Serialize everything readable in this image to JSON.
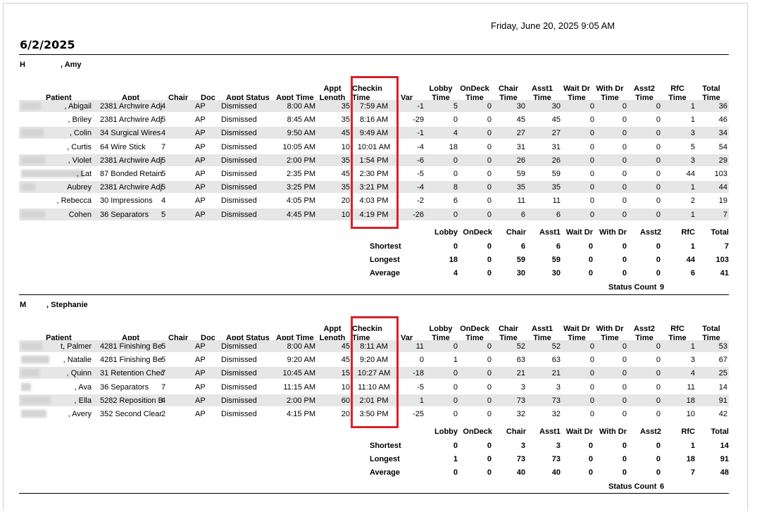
{
  "printed": "Friday, June 20, 2025 9:05 AM",
  "report_date": "6/2/2025",
  "headers": {
    "patient": "Patient",
    "appt": "Appt",
    "chair": "Chair",
    "doc": "Doc",
    "appt_status": "Appt Status",
    "appt_time": "Appt Time",
    "appt_length": [
      "Appt",
      "Length"
    ],
    "checkin": [
      "Checkin",
      "Time"
    ],
    "var": "Var",
    "lobby": [
      "Lobby",
      "Time"
    ],
    "ondeck": [
      "OnDeck",
      "Time"
    ],
    "chair_time": [
      "Chair",
      "Time"
    ],
    "asst1": [
      "Asst1",
      "Time"
    ],
    "wait_dr": [
      "Wait Dr",
      "Time"
    ],
    "with_dr": [
      "With Dr",
      "Time"
    ],
    "asst2": [
      "Asst2",
      "Time"
    ],
    "rfc": [
      "RfC",
      "Time"
    ],
    "total": [
      "Total",
      "Time"
    ]
  },
  "summary_headers": [
    "Lobby",
    "OnDeck",
    "Chair",
    "Asst1",
    "Wait Dr",
    "With Dr",
    "Asst2",
    "RfC",
    "Total"
  ],
  "status_count_label": "Status Count",
  "groups": [
    {
      "doctor": [
        "H",
        ", Amy"
      ],
      "rows": [
        {
          "patient": ", Abigail",
          "appt": "2381 Archwire Adj",
          "chair": "4",
          "doc": "AP",
          "status": "Dismissed",
          "time": "8:00 AM",
          "len": "35",
          "checkin": "7:59 AM",
          "var": "-1",
          "lobby": "5",
          "ondeck": "0",
          "chairt": "30",
          "asst1": "30",
          "waitdr": "0",
          "withdr": "0",
          "asst2": "0",
          "rfc": "1",
          "total": "36"
        },
        {
          "patient": ", Briley",
          "appt": "2381 Archwire Adj",
          "chair": "5",
          "doc": "AP",
          "status": "Dismissed",
          "time": "8:45 AM",
          "len": "35",
          "checkin": "8:16 AM",
          "var": "-29",
          "lobby": "0",
          "ondeck": "0",
          "chairt": "45",
          "asst1": "45",
          "waitdr": "0",
          "withdr": "0",
          "asst2": "0",
          "rfc": "1",
          "total": "46"
        },
        {
          "patient": ", Colin",
          "appt": "34 Surgical Wires",
          "chair": "4",
          "doc": "AP",
          "status": "Dismissed",
          "time": "9:50 AM",
          "len": "45",
          "checkin": "9:49 AM",
          "var": "-1",
          "lobby": "4",
          "ondeck": "0",
          "chairt": "27",
          "asst1": "27",
          "waitdr": "0",
          "withdr": "0",
          "asst2": "0",
          "rfc": "3",
          "total": "34"
        },
        {
          "patient": ", Curtis",
          "appt": "64 Wire Stick",
          "chair": "7",
          "doc": "AP",
          "status": "Dismissed",
          "time": "10:05 AM",
          "len": "10",
          "checkin": "10:01 AM",
          "var": "-4",
          "lobby": "18",
          "ondeck": "0",
          "chairt": "31",
          "asst1": "31",
          "waitdr": "0",
          "withdr": "0",
          "asst2": "0",
          "rfc": "5",
          "total": "54"
        },
        {
          "patient": ", Violet",
          "appt": "2381 Archwire Adj",
          "chair": "5",
          "doc": "AP",
          "status": "Dismissed",
          "time": "2:00 PM",
          "len": "35",
          "checkin": "1:54 PM",
          "var": "-6",
          "lobby": "0",
          "ondeck": "0",
          "chairt": "26",
          "asst1": "26",
          "waitdr": "0",
          "withdr": "0",
          "asst2": "0",
          "rfc": "3",
          "total": "29"
        },
        {
          "patient": ", Lat",
          "appt": "87 Bonded Retain",
          "chair": "5",
          "doc": "AP",
          "status": "Dismissed",
          "time": "2:35 PM",
          "len": "45",
          "checkin": "2:30 PM",
          "var": "-5",
          "lobby": "0",
          "ondeck": "0",
          "chairt": "59",
          "asst1": "59",
          "waitdr": "0",
          "withdr": "0",
          "asst2": "0",
          "rfc": "44",
          "total": "103"
        },
        {
          "patient": "Aubrey",
          "appt": "2381 Archwire Adj",
          "chair": "5",
          "doc": "AP",
          "status": "Dismissed",
          "time": "3:25 PM",
          "len": "35",
          "checkin": "3:21 PM",
          "var": "-4",
          "lobby": "8",
          "ondeck": "0",
          "chairt": "35",
          "asst1": "35",
          "waitdr": "0",
          "withdr": "0",
          "asst2": "0",
          "rfc": "1",
          "total": "44"
        },
        {
          "patient": ", Rebecca",
          "appt": "30 Impressions",
          "chair": "4",
          "doc": "AP",
          "status": "Dismissed",
          "time": "4:05 PM",
          "len": "20",
          "checkin": "4:03 PM",
          "var": "-2",
          "lobby": "6",
          "ondeck": "0",
          "chairt": "11",
          "asst1": "11",
          "waitdr": "0",
          "withdr": "0",
          "asst2": "0",
          "rfc": "2",
          "total": "19"
        },
        {
          "patient": "Cohen",
          "appt": "36 Separators",
          "chair": "5",
          "doc": "AP",
          "status": "Dismissed",
          "time": "4:45 PM",
          "len": "10",
          "checkin": "4:19 PM",
          "var": "-26",
          "lobby": "0",
          "ondeck": "0",
          "chairt": "6",
          "asst1": "6",
          "waitdr": "0",
          "withdr": "0",
          "asst2": "0",
          "rfc": "1",
          "total": "7"
        }
      ],
      "summary": [
        {
          "label": "Shortest",
          "values": [
            "0",
            "0",
            "6",
            "6",
            "0",
            "0",
            "0",
            "1",
            "7"
          ]
        },
        {
          "label": "Longest",
          "values": [
            "18",
            "0",
            "59",
            "59",
            "0",
            "0",
            "0",
            "44",
            "103"
          ]
        },
        {
          "label": "Average",
          "values": [
            "4",
            "0",
            "30",
            "30",
            "0",
            "0",
            "0",
            "6",
            "41"
          ]
        }
      ],
      "status_count": "9"
    },
    {
      "doctor": [
        "M",
        ", Stephanie"
      ],
      "rows": [
        {
          "patient": "t, Palmer",
          "appt": "4281 Finishing Be",
          "chair": "5",
          "doc": "AP",
          "status": "Dismissed",
          "time": "8:00 AM",
          "len": "45",
          "checkin": "8:11 AM",
          "var": "11",
          "lobby": "0",
          "ondeck": "0",
          "chairt": "52",
          "asst1": "52",
          "waitdr": "0",
          "withdr": "0",
          "asst2": "0",
          "rfc": "1",
          "total": "53"
        },
        {
          "patient": ", Natalie",
          "appt": "4281 Finishing Be",
          "chair": "5",
          "doc": "AP",
          "status": "Dismissed",
          "time": "9:20 AM",
          "len": "45",
          "checkin": "9:20 AM",
          "var": "0",
          "lobby": "1",
          "ondeck": "0",
          "chairt": "63",
          "asst1": "63",
          "waitdr": "0",
          "withdr": "0",
          "asst2": "0",
          "rfc": "3",
          "total": "67"
        },
        {
          "patient": ", Quinn",
          "appt": "31 Retention Chec",
          "chair": "7",
          "doc": "AP",
          "status": "Dismissed",
          "time": "10:45 AM",
          "len": "15",
          "checkin": "10:27 AM",
          "var": "-18",
          "lobby": "0",
          "ondeck": "0",
          "chairt": "21",
          "asst1": "21",
          "waitdr": "0",
          "withdr": "0",
          "asst2": "0",
          "rfc": "4",
          "total": "25"
        },
        {
          "patient": ", Ava",
          "appt": "36 Separators",
          "chair": "7",
          "doc": "AP",
          "status": "Dismissed",
          "time": "11:15 AM",
          "len": "10",
          "checkin": "11:10 AM",
          "var": "-5",
          "lobby": "0",
          "ondeck": "0",
          "chairt": "3",
          "asst1": "3",
          "waitdr": "0",
          "withdr": "0",
          "asst2": "0",
          "rfc": "11",
          "total": "14"
        },
        {
          "patient": ", Ella",
          "appt": "5282 Reposition B",
          "chair": "4",
          "doc": "AP",
          "status": "Dismissed",
          "time": "2:00 PM",
          "len": "60",
          "checkin": "2:01 PM",
          "var": "1",
          "lobby": "0",
          "ondeck": "0",
          "chairt": "73",
          "asst1": "73",
          "waitdr": "0",
          "withdr": "0",
          "asst2": "0",
          "rfc": "18",
          "total": "91"
        },
        {
          "patient": ", Avery",
          "appt": "352 Second Clear",
          "chair": "2",
          "doc": "AP",
          "status": "Dismissed",
          "time": "4:15 PM",
          "len": "20",
          "checkin": "3:50 PM",
          "var": "-25",
          "lobby": "0",
          "ondeck": "0",
          "chairt": "32",
          "asst1": "32",
          "waitdr": "0",
          "withdr": "0",
          "asst2": "0",
          "rfc": "10",
          "total": "42"
        }
      ],
      "summary": [
        {
          "label": "Shortest",
          "values": [
            "0",
            "0",
            "3",
            "3",
            "0",
            "0",
            "0",
            "1",
            "14"
          ]
        },
        {
          "label": "Longest",
          "values": [
            "1",
            "0",
            "73",
            "73",
            "0",
            "0",
            "0",
            "18",
            "91"
          ]
        },
        {
          "label": "Average",
          "values": [
            "0",
            "0",
            "40",
            "40",
            "0",
            "0",
            "0",
            "7",
            "48"
          ]
        }
      ],
      "status_count": "6"
    }
  ]
}
